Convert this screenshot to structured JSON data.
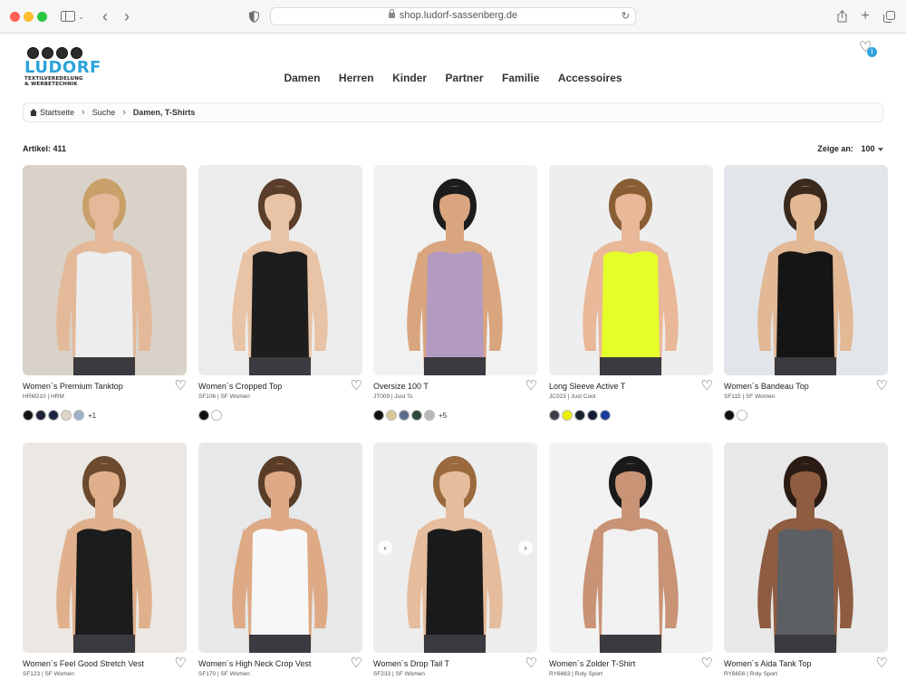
{
  "browser": {
    "url": "shop.ludorf-sassenberg.de"
  },
  "site": {
    "logo_text": "LUDORF",
    "logo_sub1": "TEXTILVEREDELUNG",
    "logo_sub2": "& WERBETECHNIK",
    "nav": [
      "Damen",
      "Herren",
      "Kinder",
      "Partner",
      "Familie",
      "Accessoires"
    ],
    "wishlist_count": "1"
  },
  "breadcrumb": {
    "home": "Startseite",
    "search": "Suche",
    "current": "Damen, T-Shirts"
  },
  "listing": {
    "count_label": "Artikel: 411",
    "show_label": "Zeige an:",
    "show_value": "100"
  },
  "products": [
    {
      "name": "Women´s Premium Tanktop",
      "sku": "HRM210 | HRM",
      "colors": [
        "#121212",
        "#1d2434",
        "#1c2445",
        "#ddd6c8",
        "#9eaec6"
      ],
      "more": "+1",
      "bg": "#d8d2c8",
      "shirt": "#ededee",
      "skin": "#e3b999",
      "hair": "#c9a06a"
    },
    {
      "name": "Women´s Cropped Top",
      "sku": "SF106 | SF Women",
      "colors": [
        "#111111",
        "#ffffff"
      ],
      "more": "",
      "bg": "#ececec",
      "shirt": "#1d1d1d",
      "skin": "#e8c3a5",
      "hair": "#5a3e2b"
    },
    {
      "name": "Oversize 100 T",
      "sku": "JT009 | Just Ts",
      "colors": [
        "#111111",
        "#d9c79a",
        "#5b6b8a",
        "#2f4a38",
        "#b9b9b9"
      ],
      "more": "+5",
      "bg": "#f1f1f1",
      "shirt": "#b39ac0",
      "skin": "#d9a57e",
      "hair": "#1c1c1c"
    },
    {
      "name": "Long Sleeve Active T",
      "sku": "JC023 | Just Cool",
      "colors": [
        "#3b3f45",
        "#e8f000",
        "#1a1f2e",
        "#141b36",
        "#1a3c9c"
      ],
      "more": "",
      "bg": "#eeeeee",
      "shirt": "#e5ff2a",
      "skin": "#e9b899",
      "hair": "#8a5e35"
    },
    {
      "name": "Women´s Bandeau Top",
      "sku": "SF115 | SF Women",
      "colors": [
        "#111111",
        "#ffffff"
      ],
      "more": "",
      "bg": "#e2e6ea",
      "shirt": "#151515",
      "skin": "#e2b895",
      "hair": "#3a2a1e"
    },
    {
      "name": "Women´s Feel Good Stretch Vest",
      "sku": "SF123 | SF Women",
      "colors": [],
      "more": "",
      "bg": "#ebe7e2",
      "shirt": "#1c1c1c",
      "skin": "#e0b08c",
      "hair": "#6b4a2e"
    },
    {
      "name": "Women´s High Neck Crop Vest",
      "sku": "SF170 | SF Women",
      "colors": [],
      "more": "",
      "bg": "#e6e8ea",
      "shirt": "#f7f7f7",
      "skin": "#deaa85",
      "hair": "#5a3d28"
    },
    {
      "name": "Women´s Drop Tail T",
      "sku": "SF233 | SF Women",
      "colors": [],
      "more": "",
      "bg": "#ededed",
      "shirt": "#1a1a1a",
      "skin": "#e5bc9c",
      "hair": "#9a6a3e"
    },
    {
      "name": "Women´s Zolder T-Shirt",
      "sku": "RY6663 | Roly Sport",
      "colors": [],
      "more": "",
      "bg": "#f2f2f2",
      "shirt": "#f1f1f1",
      "skin": "#c99376",
      "hair": "#1a1a1a"
    },
    {
      "name": "Women´s Aida Tank Top",
      "sku": "RY6656 | Roly Sport",
      "colors": [],
      "more": "",
      "bg": "#e8e8e8",
      "shirt": "#5c5f64",
      "skin": "#8e5c41",
      "hair": "#2a1c14"
    }
  ],
  "carousel": {
    "prev": "‹",
    "next": "›"
  }
}
